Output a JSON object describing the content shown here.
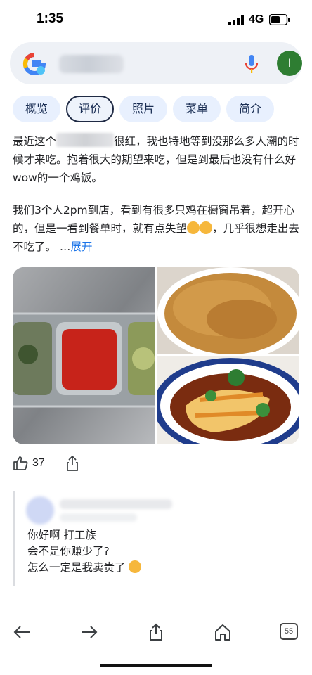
{
  "status_bar": {
    "time": "1:35",
    "network": "4G"
  },
  "search": {
    "account_initial": "I"
  },
  "tabs": [
    {
      "label": "概览"
    },
    {
      "label": "评价"
    },
    {
      "label": "照片"
    },
    {
      "label": "菜单"
    },
    {
      "label": "简介"
    }
  ],
  "review": {
    "p1_before": "最近这个",
    "p1_after": "很红，我也特地等到没那么多人潮的时候才来吃。抱着很大的期望来吃，但是到最后也没有什么好wow的一个鸡饭。",
    "p2": "我们3个人2pm到店，看到有很多只鸡在橱窗吊着，超开心的，但是一看到餐单时，就有点失望",
    "p2_tail": "，几乎很想走出去不吃了。 …",
    "more_label": "展开"
  },
  "actions": {
    "likes": "37"
  },
  "owner_reply": {
    "line1": "你好啊 打工族",
    "line2": "会不是你赚少了?",
    "line3": "怎么一定是我卖贵了"
  },
  "toolbar": {
    "tab_count": "55"
  },
  "colors": {
    "accent": "#1a73e8",
    "avatar": "#2e7d32",
    "chip": "#e8f0fe"
  }
}
